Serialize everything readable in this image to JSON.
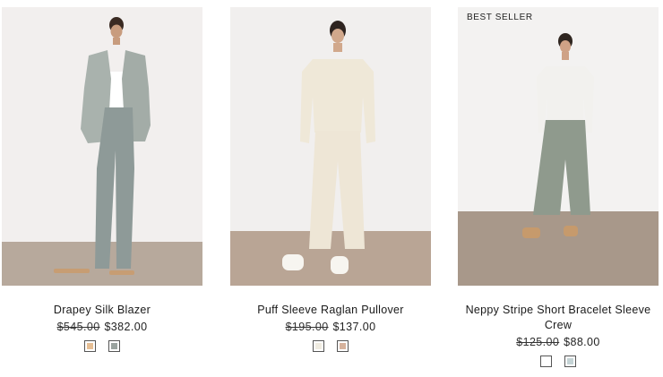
{
  "products": [
    {
      "name": "Drapey Silk Blazer",
      "was_price": "$545.00",
      "now_price": "$382.00",
      "badge": "",
      "swatch_colors": [
        "#e6bf95",
        "#9aa39f"
      ]
    },
    {
      "name": "Puff Sleeve Raglan Pullover",
      "was_price": "$195.00",
      "now_price": "$137.00",
      "badge": "",
      "swatch_colors": [
        "#efebe0",
        "#d6b29c"
      ]
    },
    {
      "name": "Neppy Stripe Short Bracelet Sleeve Crew",
      "was_price": "$125.00",
      "now_price": "$88.00",
      "badge": "BEST SELLER",
      "swatch_colors": [
        "#ffffff",
        "#c4d3d5"
      ]
    }
  ]
}
